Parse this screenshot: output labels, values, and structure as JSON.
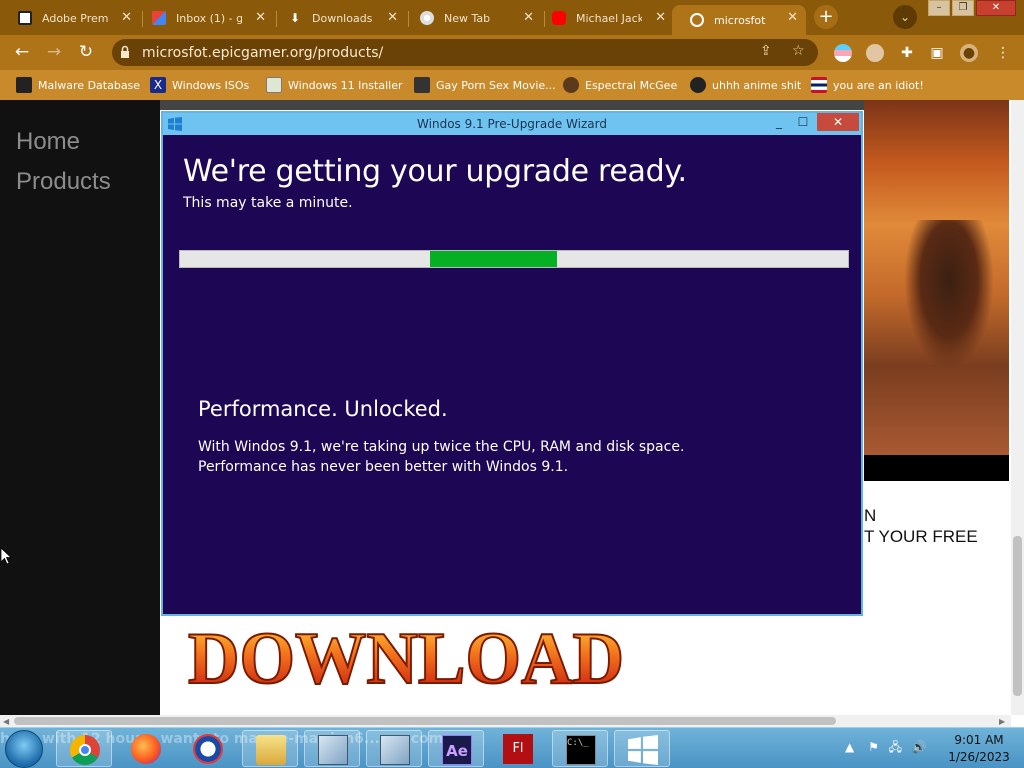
{
  "browser": {
    "tabs": [
      {
        "label": "Adobe Premi",
        "icon": "adobe-icon",
        "active": false
      },
      {
        "label": "Inbox (1) - g",
        "icon": "gmail-icon",
        "active": false
      },
      {
        "label": "Downloads",
        "icon": "download-icon",
        "active": false
      },
      {
        "label": "New Tab",
        "icon": "chrome-icon",
        "active": false
      },
      {
        "label": "Michael Jack",
        "icon": "youtube-icon",
        "active": false
      },
      {
        "label": "microsfot",
        "icon": "globe-icon",
        "active": true
      }
    ],
    "url": "microsfot.epicgamer.org/products/",
    "bookmarks": [
      {
        "label": "Malware Database",
        "icon": "library-icon"
      },
      {
        "label": "Windows ISOs",
        "icon": "x-icon"
      },
      {
        "label": "Windows 11 Installer",
        "icon": "image-icon"
      },
      {
        "label": "Gay Porn Sex Movie...",
        "icon": "site-icon"
      },
      {
        "label": "Espectral McGee",
        "icon": "avatar-icon"
      },
      {
        "label": "uhhh anime shit",
        "icon": "anime-icon"
      },
      {
        "label": "you are an idiot!",
        "icon": "flag-icon"
      }
    ]
  },
  "page": {
    "nav": [
      "Home",
      "Products"
    ],
    "promo_lines": [
      "N",
      "T YOUR FREE"
    ],
    "download_label": "DOWNLOAD"
  },
  "dialog": {
    "title": "Windos 9.1 Pre-Upgrade Wizard",
    "heading": "We're getting your upgrade ready.",
    "subheading": "This may take a minute.",
    "progress": {
      "start_fraction": 0.374,
      "end_fraction": 0.564
    },
    "feature_title": "Performance. Unlocked.",
    "feature_line1": "With Windos 9.1, we're taking up twice the CPU, RAM and disk space.",
    "feature_line2": "Performance has never been better with Windos 9.1."
  },
  "taskbar": {
    "marquee": "hack with 12 hours, wants to ma... e-mar jen6... g...com",
    "apps": [
      "chrome-icon",
      "firefox-icon",
      "opera-icon",
      "file-explorer-icon",
      "network-icon",
      "network-icon-2",
      "after-effects-icon",
      "flash-icon",
      "cmd-icon",
      "windows-icon"
    ],
    "time": "9:01 AM",
    "date": "1/26/2023"
  },
  "colors": {
    "dialog_bg": "#1d0654",
    "progress_fill": "#06b025",
    "titlebar": "#6ec3f0",
    "browser_frame": "#b07418"
  }
}
